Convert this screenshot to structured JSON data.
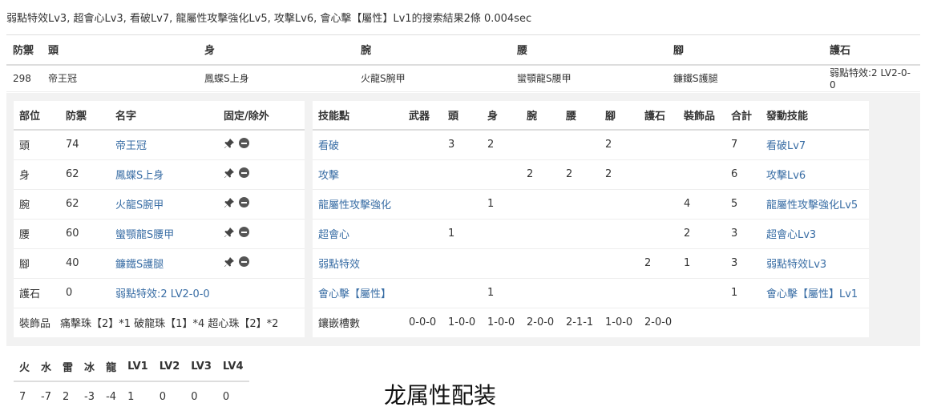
{
  "summary": "弱點特效Lv3, 超會心Lv3, 看破Lv7, 龍屬性攻擊強化Lv5, 攻擊Lv6, 會心擊【屬性】Lv1的搜索結果2條 0.004sec",
  "top_table": {
    "headers": [
      "防禦",
      "頭",
      "身",
      "腕",
      "腰",
      "腳",
      "護石"
    ],
    "row": [
      "298",
      "帝王冠",
      "鳳蝶S上身",
      "火龍S腕甲",
      "蠻顎龍S腰甲",
      "鐮鐵S護腿",
      "弱點特效:2 LV2-0-0"
    ]
  },
  "equip_table": {
    "headers": [
      "部位",
      "防禦",
      "名字",
      "固定/除外"
    ],
    "rows": [
      {
        "part": "頭",
        "def": "74",
        "name": "帝王冠"
      },
      {
        "part": "身",
        "def": "62",
        "name": "鳳蝶S上身"
      },
      {
        "part": "腕",
        "def": "62",
        "name": "火龍S腕甲"
      },
      {
        "part": "腰",
        "def": "60",
        "name": "蠻顎龍S腰甲"
      },
      {
        "part": "腳",
        "def": "40",
        "name": "鐮鐵S護腿"
      },
      {
        "part": "護石",
        "def": "0",
        "name": "弱點特效:2 LV2-0-0"
      }
    ],
    "deco_label": "裝飾品",
    "deco_value": "痛擊珠【2】*1 破龍珠【1】*4 超心珠【2】*2"
  },
  "skill_table": {
    "headers": [
      "技能點",
      "武器",
      "頭",
      "身",
      "腕",
      "腰",
      "腳",
      "護石",
      "裝飾品",
      "合計",
      "發動技能"
    ],
    "rows": [
      [
        "看破",
        "",
        "3",
        "2",
        "",
        "",
        "2",
        "",
        "",
        "7",
        "看破Lv7"
      ],
      [
        "攻擊",
        "",
        "",
        "",
        "2",
        "2",
        "2",
        "",
        "",
        "6",
        "攻擊Lv6"
      ],
      [
        "龍屬性攻擊強化",
        "",
        "",
        "1",
        "",
        "",
        "",
        "",
        "4",
        "5",
        "龍屬性攻擊強化Lv5"
      ],
      [
        "超會心",
        "",
        "1",
        "",
        "",
        "",
        "",
        "",
        "2",
        "3",
        "超會心Lv3"
      ],
      [
        "弱點特效",
        "",
        "",
        "",
        "",
        "",
        "",
        "2",
        "1",
        "3",
        "弱點特效Lv3"
      ],
      [
        "會心擊【屬性】",
        "",
        "",
        "1",
        "",
        "",
        "",
        "",
        "",
        "1",
        "會心擊【屬性】Lv1"
      ]
    ],
    "slots_row": [
      "鑲嵌槽數",
      "0-0-0",
      "1-0-0",
      "1-0-0",
      "2-0-0",
      "2-1-1",
      "1-0-0",
      "2-0-0",
      "",
      "",
      ""
    ]
  },
  "element_table": {
    "headers": [
      "火",
      "水",
      "雷",
      "冰",
      "龍",
      "LV1",
      "LV2",
      "LV3",
      "LV4"
    ],
    "values": [
      "7",
      "-7",
      "2",
      "-3",
      "-4",
      "1",
      "0",
      "0",
      "0"
    ]
  },
  "caption": "龙属性配装",
  "icons": {
    "pin": "pin-icon",
    "exclude": "minus-circle-icon"
  },
  "colors": {
    "link": "#3a6ea5",
    "panel_bg": "#f2f2f2"
  }
}
